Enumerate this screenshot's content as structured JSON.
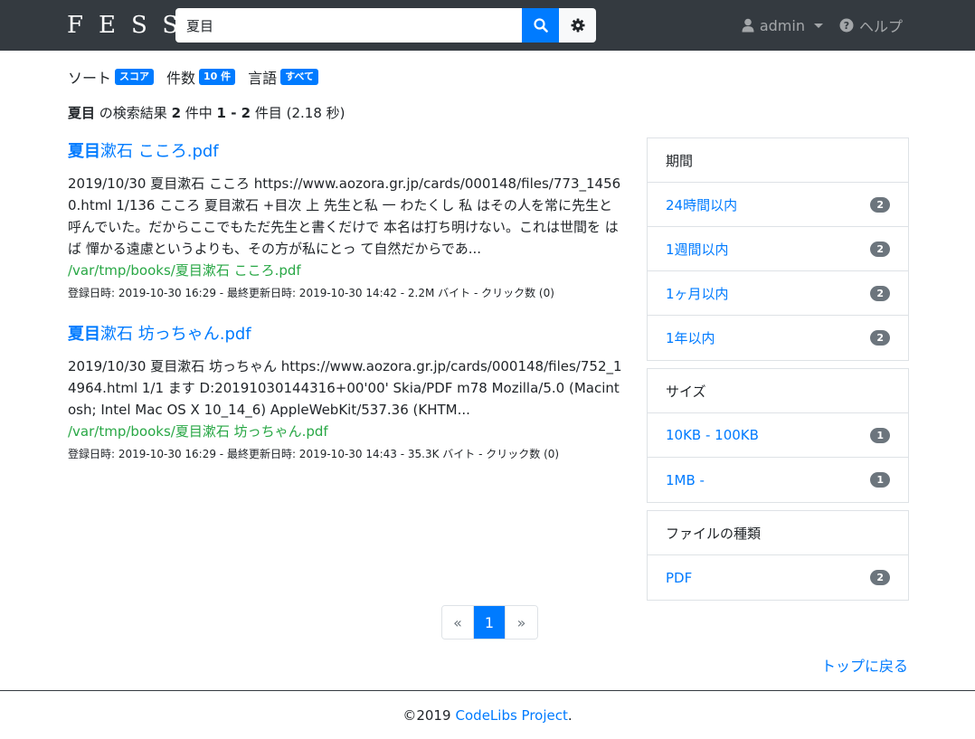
{
  "nav": {
    "brand": "FESS",
    "search_value": "夏目",
    "user_label": "admin",
    "help_label": "ヘルプ"
  },
  "options": {
    "sort_label": "ソート",
    "sort_value": "スコア",
    "count_label": "件数",
    "count_value": "10 件",
    "lang_label": "言語",
    "lang_value": "すべて"
  },
  "summary": {
    "query": "夏目",
    "text1": " の検索結果 ",
    "total": "2",
    "text2": " 件中 ",
    "range": "1 - 2",
    "text3": " 件目 (2.18 秒)"
  },
  "results": [
    {
      "title_hl": "夏目",
      "title_rest": "漱石 こころ.pdf",
      "body": "2019/10/30 夏目漱石 こころ https://www.aozora.gr.jp/cards/000148/files/773_14560.html 1/136 こころ 夏目漱石 +目次 上 先生と私 一 わたくし 私 はその人を常に先生と呼んでいた。だからここでもただ先生と書くだけで 本名は打ち明けない。これは世間を はば 憚かる遠慮というよりも、その方が私にとっ て自然だからであ...",
      "url": "/var/tmp/books/夏目漱石 こころ.pdf",
      "meta": "登録日時: 2019-10-30 16:29 - 最終更新日時: 2019-10-30 14:42 - 2.2M バイト - クリック数 (0)"
    },
    {
      "title_hl": "夏目",
      "title_rest": "漱石 坊っちゃん.pdf",
      "body": "2019/10/30 夏目漱石 坊っちゃん https://www.aozora.gr.jp/cards/000148/files/752_14964.html 1/1 ます D:20191030144316+00'00' Skia/PDF m78 Mozilla/5.0 (Macintosh; Intel Mac OS X 10_14_6) AppleWebKit/537.36 (KHTM...",
      "url": "/var/tmp/books/夏目漱石 坊っちゃん.pdf",
      "meta": "登録日時: 2019-10-30 16:29 - 最終更新日時: 2019-10-30 14:43 - 35.3K バイト - クリック数 (0)"
    }
  ],
  "facets": {
    "period": {
      "header": "期間",
      "items": [
        {
          "label": "24時間以内",
          "count": "2"
        },
        {
          "label": "1週間以内",
          "count": "2"
        },
        {
          "label": "1ヶ月以内",
          "count": "2"
        },
        {
          "label": "1年以内",
          "count": "2"
        }
      ]
    },
    "size": {
      "header": "サイズ",
      "items": [
        {
          "label": "10KB - 100KB",
          "count": "1"
        },
        {
          "label": "1MB -",
          "count": "1"
        }
      ]
    },
    "filetype": {
      "header": "ファイルの種類",
      "items": [
        {
          "label": "PDF",
          "count": "2"
        }
      ]
    }
  },
  "pagination": {
    "prev": "«",
    "current": "1",
    "next": "»"
  },
  "back_to_top": "トップに戻る",
  "footer": {
    "copyright": "©2019",
    "link": "CodeLibs Project",
    "suffix": "."
  }
}
